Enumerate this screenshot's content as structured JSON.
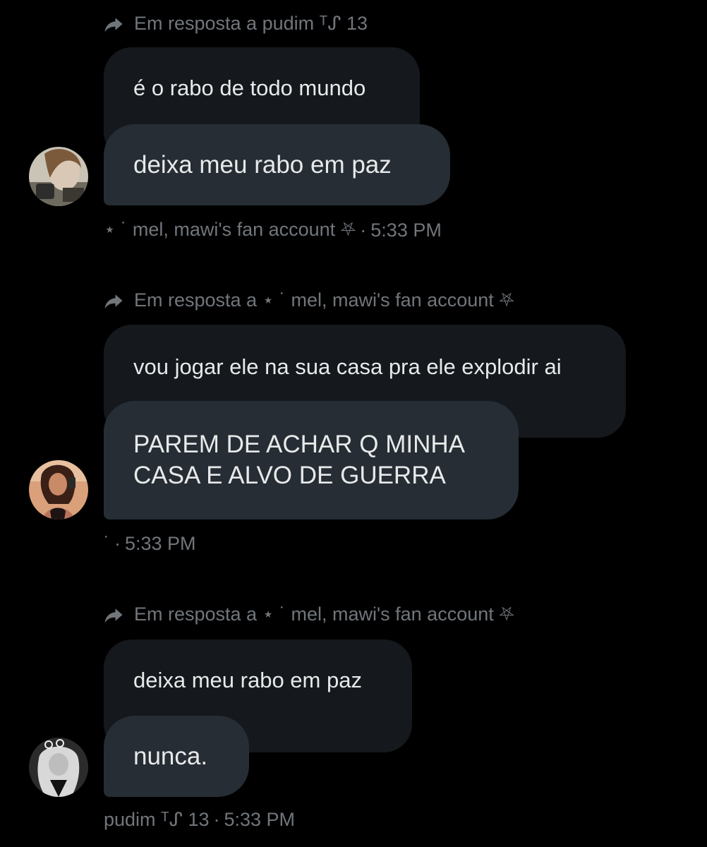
{
  "messages": [
    {
      "reply_text": "Em resposta a pudim ᵀᔑ 13",
      "quoted_text": "é o rabo de todo mundo",
      "main_text": "deixa meu rabo em paz",
      "sender": "⋆ ˙ mel, mawi's fan account ⛧",
      "separator": "·",
      "time": "5:33 PM"
    },
    {
      "reply_text": "Em resposta a ⋆ ˙ mel, mawi's fan account ⛧",
      "quoted_text": "vou jogar ele na sua casa pra ele explodir ai",
      "main_text": "PAREM DE ACHAR Q MINHA CASA E ALVO DE GUERRA",
      "sender": "˙",
      "separator": "·",
      "time": "5:33 PM"
    },
    {
      "reply_text": "Em resposta a ⋆ ˙ mel, mawi's fan account ⛧",
      "quoted_text": "deixa meu rabo em paz",
      "main_text": "nunca.",
      "sender": "pudim ᵀᔑ 13",
      "separator": "·",
      "time": "5:33 PM"
    }
  ],
  "icons": {
    "reply": "reply-arrow-icon"
  },
  "colors": {
    "background": "#000000",
    "quoted_bubble": "#15181c",
    "main_bubble": "#262d34",
    "text": "#e7e9ea",
    "muted": "#71767b"
  }
}
